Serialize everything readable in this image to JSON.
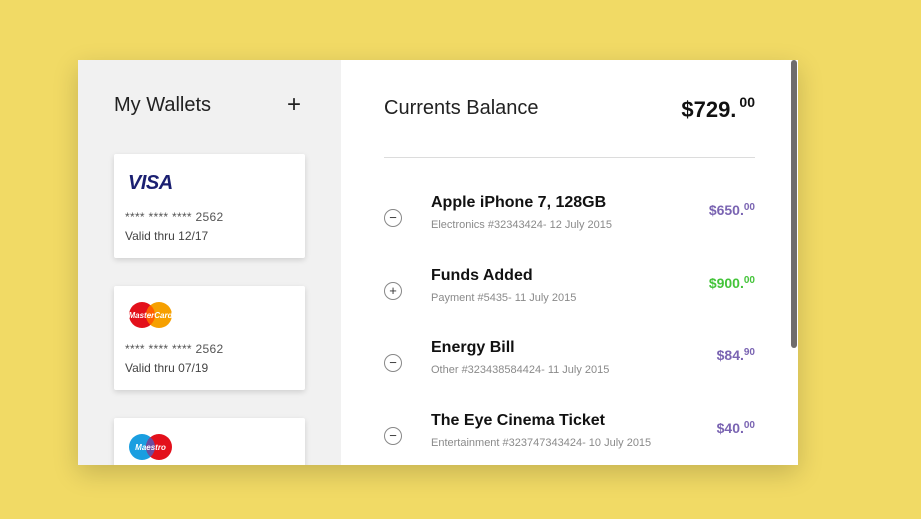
{
  "wallets": {
    "title": "My Wallets",
    "add_label": "+",
    "cards": [
      {
        "brand": "VISA",
        "number": "**** **** **** 2562",
        "valid": "Valid thru 12/17"
      },
      {
        "brand": "MasterCard",
        "number": "**** **** **** 2562",
        "valid": "Valid thru 07/19"
      },
      {
        "brand": "Maestro",
        "number": "",
        "valid": ""
      }
    ]
  },
  "balance": {
    "title": "Currents Balance",
    "amount_main": "$729.",
    "amount_cents": "00"
  },
  "transactions": [
    {
      "toggle": "−",
      "title": "Apple iPhone 7, 128GB",
      "meta": "Electronics #32343424- 12 July 2015",
      "amount_main": "$650.",
      "amount_cents": "00",
      "color": "#7a64b2"
    },
    {
      "toggle": "+",
      "title": "Funds Added",
      "meta": "Payment #5435- 11 July 2015",
      "amount_main": "$900.",
      "amount_cents": "00",
      "color": "#44c43a"
    },
    {
      "toggle": "−",
      "title": "Energy Bill",
      "meta": "Other #323438584424- 11 July 2015",
      "amount_main": "$84.",
      "amount_cents": "90",
      "color": "#7a64b2"
    },
    {
      "toggle": "−",
      "title": "The Eye Cinema Ticket",
      "meta": "Entertainment #323747343424- 10 July 2015",
      "amount_main": "$40.",
      "amount_cents": "00",
      "color": "#7a64b2"
    }
  ],
  "colors": {
    "background": "#f1da65",
    "debit": "#7a64b2",
    "credit": "#44c43a"
  }
}
